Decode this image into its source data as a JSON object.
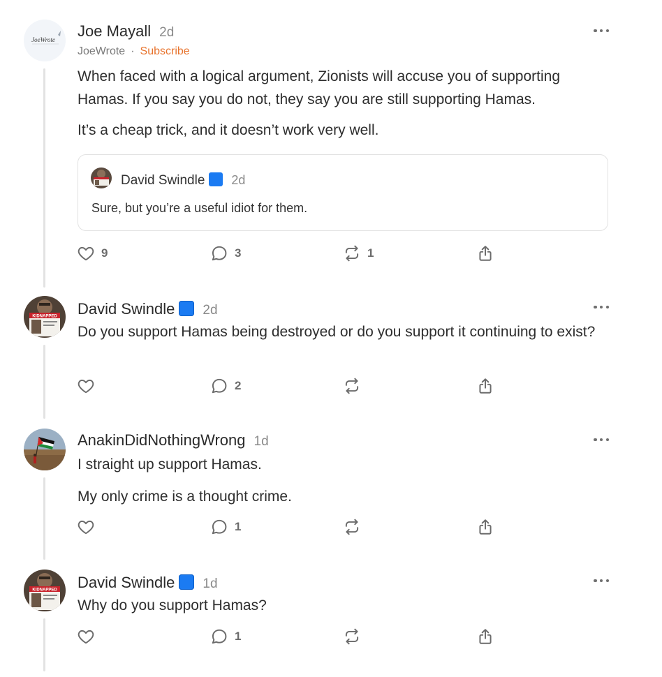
{
  "comments": [
    {
      "author": "Joe Mayall",
      "time": "2d",
      "publication": "JoeWrote",
      "separator": "·",
      "subscribe_label": "Subscribe",
      "avatar_logo_text": "JoeWrote",
      "paragraphs": [
        "When faced with a logical argument, Zionists will accuse you of supporting Hamas. If you say you do not, they say you are still supporting Hamas.",
        "It’s a cheap trick, and it doesn’t work very well."
      ],
      "quote": {
        "author": "David Swindle",
        "time": "2d",
        "text": "Sure, but you’re a useful idiot for them."
      },
      "likes": "9",
      "replies": "3",
      "restacks": "1"
    },
    {
      "author": "David Swindle",
      "time": "2d",
      "paragraphs": [
        "Do you support Hamas being destroyed or do you support it continuing to exist?"
      ],
      "likes": "",
      "replies": "2",
      "restacks": ""
    },
    {
      "author": "AnakinDidNothingWrong",
      "time": "1d",
      "paragraphs": [
        "I straight up support Hamas.",
        "My only crime is a thought crime."
      ],
      "likes": "",
      "replies": "1",
      "restacks": ""
    },
    {
      "author": "David Swindle",
      "time": "1d",
      "paragraphs": [
        "Why do you support Hamas?"
      ],
      "likes": "",
      "replies": "1",
      "restacks": ""
    }
  ],
  "avatar_sign_text": "KIDNAPPED",
  "icons": [
    "heart-icon",
    "comment-bubble-icon",
    "restack-icon",
    "share-icon",
    "more-options-icon",
    "verified-badge-icon"
  ],
  "colors": {
    "accent_subscribe": "#e8742e",
    "verified_badge": "#1b7bf2",
    "muted_text": "#8a8a8a"
  }
}
